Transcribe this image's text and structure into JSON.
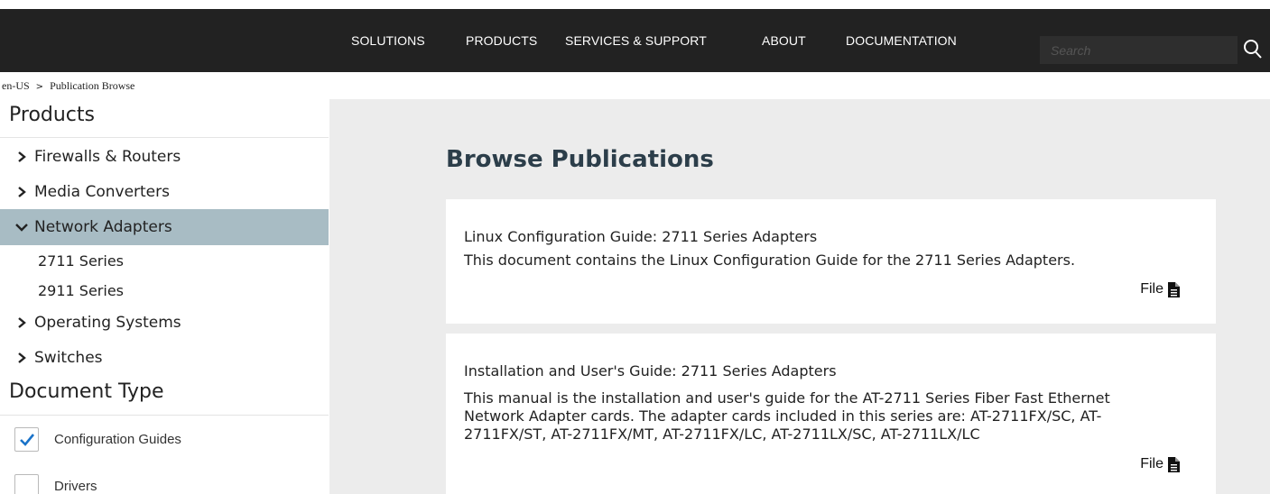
{
  "nav": {
    "items": [
      "SOLUTIONS",
      "PRODUCTS",
      "SERVICES & SUPPORT",
      "ABOUT",
      "DOCUMENTATION"
    ],
    "search_placeholder": "Search",
    "search_icon": "search-icon"
  },
  "breadcrumb": {
    "items": [
      "en-US",
      "Publication Browse"
    ],
    "separator_icon": "chevron-right-icon"
  },
  "sidebar": {
    "products_heading": "Products",
    "products": [
      {
        "label": "Firewalls & Routers",
        "expanded": false
      },
      {
        "label": "Media Converters",
        "expanded": false
      },
      {
        "label": "Network Adapters",
        "expanded": true
      },
      {
        "label": "Operating Systems",
        "expanded": false
      },
      {
        "label": "Switches",
        "expanded": false
      }
    ],
    "network_adapters_children": [
      "2711 Series",
      "2911 Series"
    ],
    "doc_type_heading": "Document Type",
    "doc_types": [
      {
        "label": "Configuration Guides",
        "checked": true
      },
      {
        "label": "Drivers",
        "checked": false
      }
    ],
    "active_color": "#a8bcc4"
  },
  "main": {
    "title": "Browse Publications",
    "publications": [
      {
        "title": "Linux Configuration Guide: 2711 Series Adapters",
        "description": "This document contains the Linux Configuration Guide for the 2711 Series Adapters.",
        "file_label": "File",
        "file_icon": "document-icon"
      },
      {
        "title": "Installation and User's Guide: 2711 Series Adapters",
        "description": "This manual is the installation and user's guide for the AT-2711 Series Fiber Fast Ethernet Network Adapter cards. The adapter cards included in this series are: AT-2711FX/SC, AT-2711FX/ST, AT-2711FX/MT, AT-2711FX/LC, AT-2711LX/SC, AT-2711LX/LC",
        "file_label": "File",
        "file_icon": "document-icon"
      }
    ]
  },
  "colors": {
    "topbar": "#222222",
    "main_background": "#ececec",
    "title_color": "#2c3e4a",
    "checkbox_check": "#1a73c9"
  }
}
